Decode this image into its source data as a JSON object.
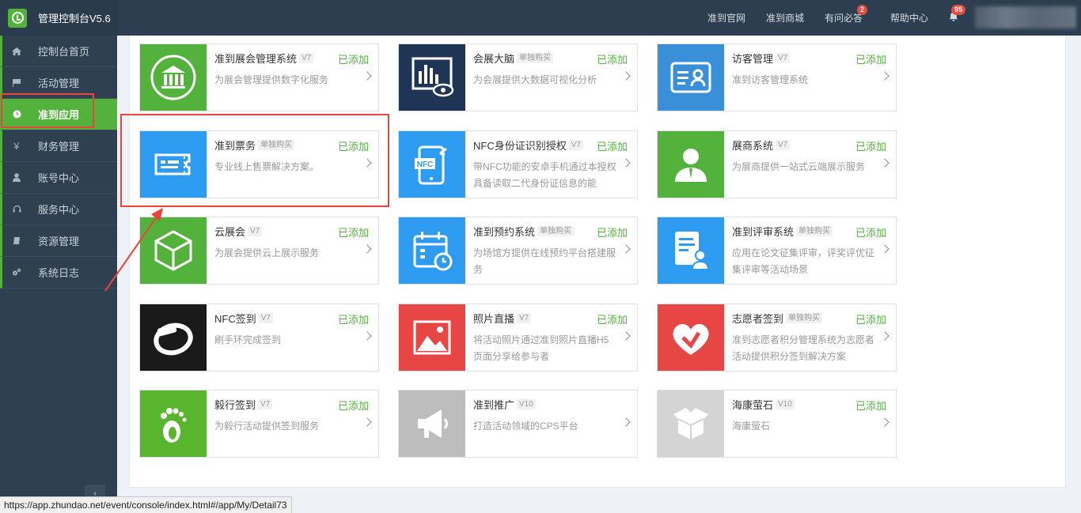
{
  "brand": {
    "title": "管理控制台V5.6"
  },
  "topnav": {
    "items": [
      {
        "label": "准到官网"
      },
      {
        "label": "准到商城"
      },
      {
        "label": "有问必答",
        "badge": "2"
      },
      {
        "label": "帮助中心"
      }
    ],
    "notification_badge": "95"
  },
  "sidebar": {
    "items": [
      {
        "label": "控制台首页",
        "icon": "home-icon"
      },
      {
        "label": "活动管理",
        "icon": "flag-icon"
      },
      {
        "label": "准到应用",
        "icon": "clock-icon",
        "active": true
      },
      {
        "label": "财务管理",
        "icon": "yen-icon"
      },
      {
        "label": "账号中心",
        "icon": "user-icon"
      },
      {
        "label": "服务中心",
        "icon": "headset-icon"
      },
      {
        "label": "资源管理",
        "icon": "book-icon"
      },
      {
        "label": "系统日志",
        "icon": "gears-icon"
      }
    ]
  },
  "apps": [
    {
      "title": "准到展会管理系统",
      "tag": "V7",
      "status": "已添加",
      "desc": "为展会管理提供数字化服务",
      "color": "#52b23c",
      "icon": "museum-icon"
    },
    {
      "title": "会展大脑",
      "tag": "单独购买",
      "status": "已添加",
      "desc": "为会展提供大数据可视化分析",
      "color": "#1f3556",
      "icon": "analytics-eye-icon"
    },
    {
      "title": "访客管理",
      "tag": "V7",
      "status": "已添加",
      "desc": "准到访客管理系统",
      "color": "#3a8fd9",
      "icon": "id-card-icon"
    },
    {
      "title": "准到票务",
      "tag": "单独购买",
      "status": "已添加",
      "desc": "专业线上售票解决方案。",
      "color": "#2d9bf0",
      "icon": "ticket-icon"
    },
    {
      "title": "NFC身份证识别授权",
      "tag": "V7",
      "status": "已添加",
      "desc": "带NFC功能的安卓手机通过本授权具备读取二代身份证信息的能",
      "color": "#2d9bf0",
      "icon": "nfc-phone-icon"
    },
    {
      "title": "展商系统",
      "tag": "V7",
      "status": "已添加",
      "desc": "为展商提供一站式云端展示服务",
      "color": "#52b23c",
      "icon": "person-icon"
    },
    {
      "title": "云展会",
      "tag": "V7",
      "status": "已添加",
      "desc": "为展会提供云上展示服务",
      "color": "#52b23c",
      "icon": "cube-icon"
    },
    {
      "title": "准到预约系统",
      "tag": "单独购买",
      "status": "已添加",
      "desc": "为场馆方提供在线预约平台搭建服务",
      "color": "#2d9bf0",
      "icon": "calendar-icon"
    },
    {
      "title": "准到评审系统",
      "tag": "单独购买",
      "status": "已添加",
      "desc": "应用在论文征集评审，评奖评优征集评审等活动场景",
      "color": "#2d9bf0",
      "icon": "review-doc-icon"
    },
    {
      "title": "NFC签到",
      "tag": "V7",
      "status": "已添加",
      "desc": "刷手环完成签到",
      "color": "#1a1a1a",
      "icon": "wristband-icon"
    },
    {
      "title": "照片直播",
      "tag": "V7",
      "status": "已添加",
      "desc": "将活动照片通过准到照片直播H5页面分享给参与者",
      "color": "#e84545",
      "icon": "photo-icon"
    },
    {
      "title": "志愿者签到",
      "tag": "单独购买",
      "status": "已添加",
      "desc": "准到志愿者积分管理系统为志愿者活动提供积分签到解决方案",
      "color": "#e84545",
      "icon": "heart-hand-icon"
    },
    {
      "title": "毅行签到",
      "tag": "V7",
      "status": "已添加",
      "desc": "为毅行活动提供签到服务",
      "color": "#5ab52e",
      "icon": "footprint-icon"
    },
    {
      "title": "准到推广",
      "tag": "V10",
      "status": "",
      "desc": "打造活动领域的CPS平台",
      "color": "#bdbdbd",
      "icon": "megaphone-icon"
    },
    {
      "title": "海康萤石",
      "tag": "V10",
      "status": "已添加",
      "desc": "海康萤石",
      "color": "#d4d4d4",
      "icon": "box-icon"
    }
  ],
  "status_url": "https://app.zhundao.net/event/console/index.html#/app/My/Detail73"
}
